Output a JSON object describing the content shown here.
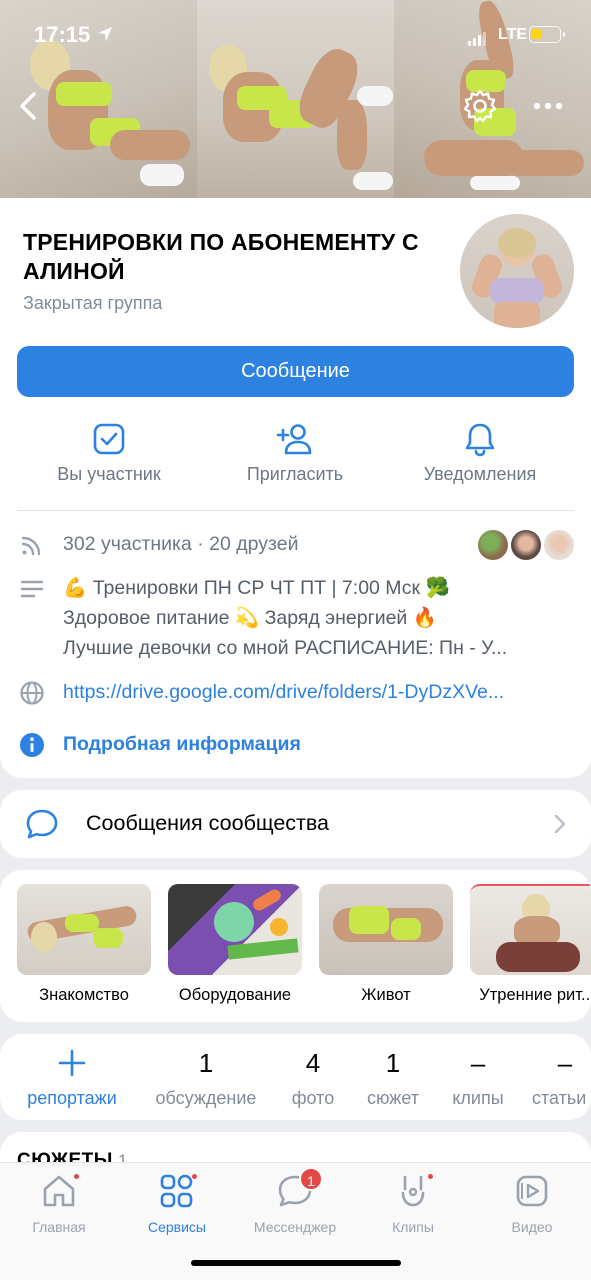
{
  "status_bar": {
    "time": "17:15",
    "network": "LTE"
  },
  "group": {
    "title": "ТРЕНИРОВКИ ПО АБОНЕМЕНТУ С АЛИНОЙ",
    "type": "Закрытая группа",
    "message_button": "Сообщение"
  },
  "actions": [
    {
      "label": "Вы участник",
      "icon": "checkbox-icon"
    },
    {
      "label": "Пригласить",
      "icon": "add-user-icon"
    },
    {
      "label": "Уведомления",
      "icon": "bell-icon"
    }
  ],
  "info": {
    "members": "302 участника · 20 друзей",
    "description_lines": [
      "💪 Тренировки ПН СР ЧТ ПТ | 7:00 Мск 🥦",
      "Здоровое питание  💫 Заряд энергией 🔥",
      "Лучшие девочки со мной РАСПИСАНИЕ:  Пн - У..."
    ],
    "link": "https://drive.google.com/drive/folders/1-DyDzXVe...",
    "more_info": "Подробная информация"
  },
  "community_messages": {
    "label": "Сообщения сообщества"
  },
  "albums": [
    {
      "caption": "Знакомство"
    },
    {
      "caption": "Оборудование"
    },
    {
      "caption": "Живот"
    },
    {
      "caption": "Утренние рит..."
    }
  ],
  "counters": [
    {
      "num": "+",
      "caption": "репортажи"
    },
    {
      "num": "1",
      "caption": "обсуждение"
    },
    {
      "num": "4",
      "caption": "фото"
    },
    {
      "num": "1",
      "caption": "сюжет"
    },
    {
      "num": "–",
      "caption": "клипы"
    },
    {
      "num": "–",
      "caption": "статьи"
    }
  ],
  "stories_section": {
    "label": "СЮЖЕТЫ",
    "count": "1"
  },
  "tabbar": [
    {
      "label": "Главная",
      "icon": "home-icon"
    },
    {
      "label": "Сервисы",
      "icon": "services-icon"
    },
    {
      "label": "Мессенджер",
      "icon": "messenger-icon",
      "badge": "1"
    },
    {
      "label": "Клипы",
      "icon": "clips-icon"
    },
    {
      "label": "Видео",
      "icon": "video-icon"
    }
  ],
  "colors": {
    "accent": "#2d81e0",
    "suit": "#c8e64a",
    "notification": "#e64646"
  }
}
